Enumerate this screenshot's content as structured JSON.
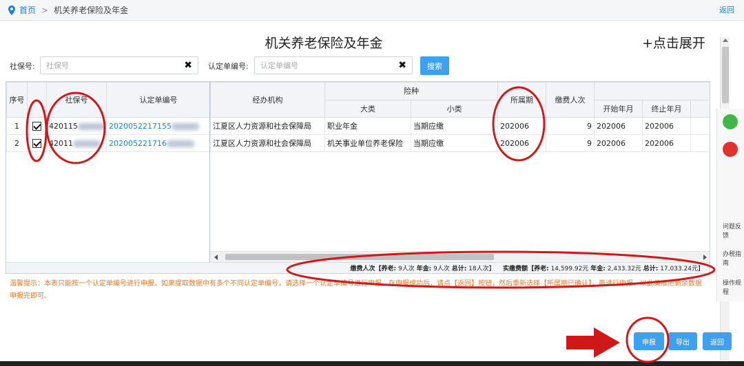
{
  "breadcrumb": {
    "home": "首页",
    "separator": ">",
    "current": "机关养老保险及年金",
    "back_link": "返回"
  },
  "page": {
    "title": "机关养老保险及年金",
    "expand": "+点击展开"
  },
  "search": {
    "ssn_label": "社保号:",
    "ssn_placeholder": "社保号",
    "cert_label": "认定单编号:",
    "cert_placeholder": "认定单编号",
    "clear_glyph": "✖",
    "button": "搜索"
  },
  "grid": {
    "frozen_headers": [
      "序号",
      "",
      "社保号",
      "认定单编号"
    ],
    "headers": {
      "agency": "经办机构",
      "insurance": "险种",
      "major": "大类",
      "minor": "小类",
      "period": "所属期",
      "persons": "缴费人次",
      "start": "开始年月",
      "end": "终止年月",
      "pay_partial": "缴"
    },
    "rows": [
      {
        "seq": "1",
        "checked": true,
        "ssn": "420115",
        "cert": "2020052217155",
        "agency": "江夏区人力资源和社会保障局",
        "major": "职业年金",
        "minor": "当期应缴",
        "period": "202006",
        "persons": "9",
        "start": "202006",
        "end": "202006"
      },
      {
        "seq": "2",
        "checked": true,
        "ssn": "42011",
        "cert": "202005221716",
        "agency": "江夏区人力资源和社会保障局",
        "major": "机关事业单位养老保险",
        "minor": "当期应缴",
        "period": "202006",
        "persons": "9",
        "start": "202006",
        "end": "202006"
      }
    ]
  },
  "summary": {
    "persons_label": "缴费人次【养老:",
    "persons_pension": "9人次",
    "persons_annuity_label": "年金:",
    "persons_annuity": "9人次",
    "persons_total_label": "总计:",
    "persons_total": "18人次】",
    "amount_label": "实缴费额【养老:",
    "amount_pension": "14,599.92元",
    "amount_annuity_label": "年金:",
    "amount_annuity": "2,433.32元",
    "amount_total_label": "总计:",
    "amount_total": "17,033.24元】"
  },
  "tip": {
    "text": "温馨提示：本表只能按一个认定单编号进行申报，如果提取数据中有多个不同认定单编号，请选择一个认定单编号进行申报，在申报成功后，请点【返回】按钮，然后重新选择【所属期已确认】，再进行申报，以此类推把剩余数据申报完即可。"
  },
  "sidebar": {
    "wechat_icon": "wechat-icon",
    "weibo_icon": "weibo-icon",
    "app_icon": "app-icon",
    "feedback": "问题反馈",
    "guide": "办税指南",
    "rules": "操作规程"
  },
  "actions": {
    "submit": "申报",
    "export": "导出",
    "back": "返回"
  },
  "colors": {
    "accent": "#3ea1ee",
    "link": "#1e7fd6",
    "tip": "#e47a2c",
    "annotation": "#d01818"
  }
}
